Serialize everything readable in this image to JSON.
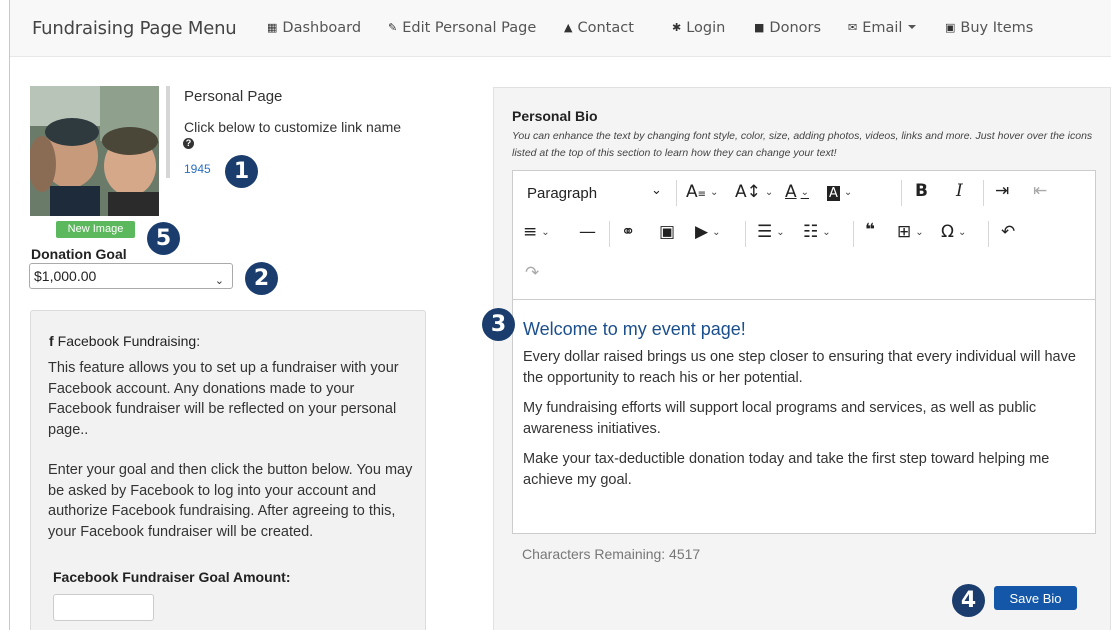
{
  "navbar": {
    "brand": "Fundraising Page Menu",
    "items": [
      {
        "label": "Dashboard",
        "icon": "grid-icon"
      },
      {
        "label": "Edit Personal Page",
        "icon": "pencil-icon"
      },
      {
        "label": "Contact",
        "icon": "user-icon"
      },
      {
        "label": "Login",
        "icon": "asterisk-icon"
      },
      {
        "label": "Donors",
        "icon": "briefcase-icon"
      },
      {
        "label": "Email",
        "icon": "envelope-icon"
      },
      {
        "label": "Buy Items",
        "icon": "money-icon"
      }
    ]
  },
  "profile": {
    "title": "Personal Page",
    "hint": "Click below to customize link name",
    "help_icon": "?",
    "link": "1945",
    "new_image_label": "New Image"
  },
  "donation_goal": {
    "label": "Donation Goal",
    "selected": "$1,000.00"
  },
  "facebook": {
    "icon": "f",
    "title": "Facebook Fundraising:",
    "para1": "This feature allows you to set up a fundraiser with your Facebook account. Any donations made to your Facebook fundraiser will be reflected on your personal page..",
    "para2": "Enter your goal and then click the button below. You may be asked by Facebook to log into your account and authorize Facebook fundraising. After agreeing to this, your Facebook fundraiser will be created.",
    "goal_label": "Facebook Fundraiser Goal Amount:",
    "goal_value": ""
  },
  "bio": {
    "title": "Personal Bio",
    "help": "You can enhance the text by changing font style, color, size, adding photos, videos, links and more. Just hover over the icons listed at the top of this section to learn how they can change your text!",
    "paragraph_style": "Paragraph",
    "heading": "Welcome to my event page!",
    "p1": "Every dollar raised brings us one step closer to ensuring that every individual will have the opportunity to reach his or her potential.",
    "p2": "My fundraising efforts will support local programs and services, as well as public awareness initiatives.",
    "p3": "Make your tax-deductible donation today and take the first step toward helping me achieve my goal.",
    "chars_remaining": "Characters Remaining: 4517",
    "save_label": "Save Bio"
  },
  "callouts": [
    "1",
    "2",
    "3",
    "4",
    "5"
  ],
  "colors": {
    "callout": "#1a3d6e",
    "link": "#2a6fbf",
    "heading": "#1b4f8c",
    "save_button": "#1457a8",
    "new_image_button": "#5cb85c"
  }
}
